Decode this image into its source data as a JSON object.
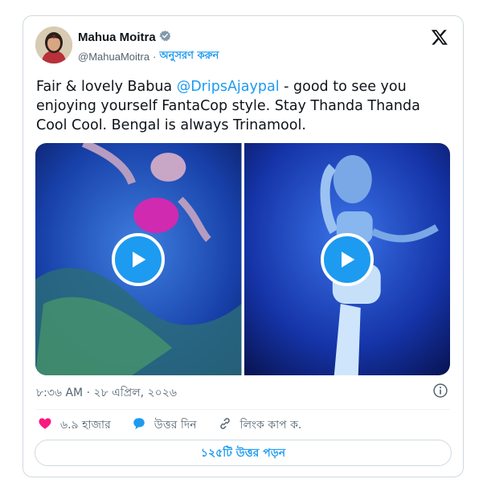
{
  "author": {
    "name": "Mahua Moitra",
    "handle": "@MahuaMoitra",
    "separator": "·",
    "follow_label": "অনুসরণ করুন",
    "verified": true
  },
  "tweet": {
    "text_before": "Fair & lovely Babua ",
    "mention": "@DripsAjaypal",
    "text_after": " - good to see you enjoying yourself FantaCop style. Stay Thanda Thanda Cool Cool. Bengal is always Trinamool.",
    "timestamp": "৮:৩৬ AM · ২৮ এপ্রিল, ২০২৬"
  },
  "media": {
    "videos": [
      {
        "label": "video-1"
      },
      {
        "label": "video-2"
      }
    ]
  },
  "actions": {
    "likes": "৬.৯ হাজার",
    "reply_label": "উত্তর দিন",
    "copy_link_label": "লিংক কাপ ক."
  },
  "replies_button": "১২৫টি উত্তর পড়ন",
  "colors": {
    "accent": "#1d9bf0",
    "like": "#f91880",
    "text_secondary": "#536471",
    "border": "#cfd9de"
  }
}
